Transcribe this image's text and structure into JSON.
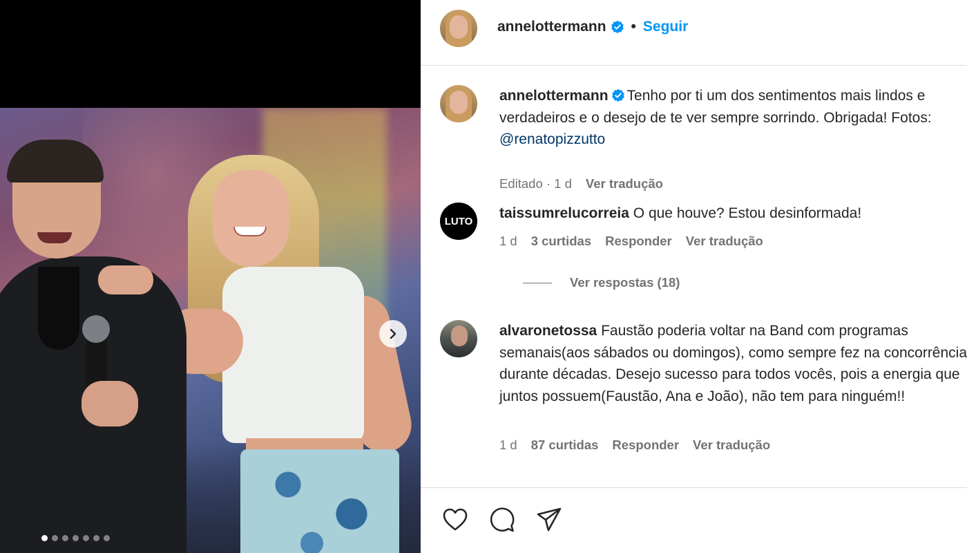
{
  "post": {
    "author": "annelottermann",
    "follow_label": "Seguir",
    "separator": "•",
    "caption": {
      "username": "annelottermann",
      "text": "Tenho por ti um dos sentimentos mais lindos e verdadeiros e o desejo de te ver sempre sorrindo. Obrigada! Fotos: ",
      "mention": "@renatopizzutto",
      "meta_edited": "Editado · 1 d",
      "translate_label": "Ver tradução"
    },
    "carousel": {
      "slides": 7,
      "active": 0
    }
  },
  "comments": [
    {
      "username": "taissumrelucorreia",
      "avatar_text": "LUTO",
      "text": "O que houve? Estou desinformada!",
      "time": "1 d",
      "likes": "3 curtidas",
      "reply_label": "Responder",
      "translate_label": "Ver tradução",
      "replies_label": "Ver respostas (18)"
    },
    {
      "username": "alvaronetossa",
      "text": "Faustão poderia voltar na Band com programas semanais(aos sábados ou domingos), como sempre fez na concorrência durante décadas. Desejo sucesso para todos vocês, pois a energia que juntos possuem(Faustão, Ana e João), não tem para ninguém!!",
      "time": "1 d",
      "likes": "87 curtidas",
      "reply_label": "Responder",
      "translate_label": "Ver tradução"
    }
  ],
  "icons": {
    "like": "heart-icon",
    "comment": "comment-icon",
    "share": "share-icon",
    "next": "chevron-right-icon",
    "verified": "verified-badge-icon"
  },
  "colors": {
    "accent": "#0095f6",
    "verified": "#0095f6",
    "mention": "#00376b",
    "muted": "#737373"
  }
}
